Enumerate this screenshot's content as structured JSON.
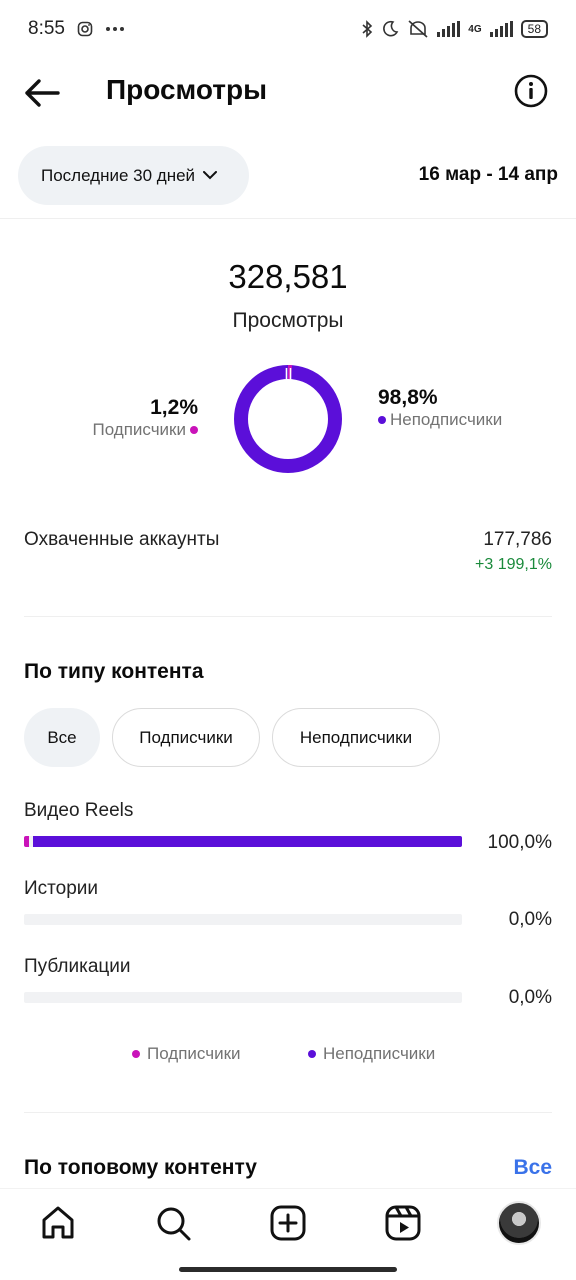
{
  "status_bar": {
    "time": "8:55",
    "network": "4G",
    "battery": "58",
    "icons": [
      "instagram-icon",
      "more-dots-icon",
      "bluetooth-icon",
      "moon-icon",
      "alarm-off-icon",
      "signal-icon",
      "battery-icon"
    ]
  },
  "header": {
    "title": "Просмотры",
    "back_icon": "arrow-left-icon",
    "info_icon": "info-icon"
  },
  "filter": {
    "period_label": "Последние 30 дней",
    "date_range": "16 мар - 14 апр"
  },
  "summary": {
    "total": "328,581",
    "total_label": "Просмотры",
    "followers_pct": "1,2%",
    "followers_label": "Подписчики",
    "non_followers_pct": "98,8%",
    "non_followers_label": "Неподписчики",
    "followers_share": 0.012,
    "non_followers_share": 0.988
  },
  "reach": {
    "label": "Охваченные аккаунты",
    "value": "177,786",
    "delta": "+3 199,1%"
  },
  "content_type": {
    "title": "По типу контента",
    "chips": [
      "Все",
      "Подписчики",
      "Неподписчики"
    ],
    "selected_chip": "Все",
    "rows": [
      {
        "label": "Видео Reels",
        "value": "100,0%",
        "followers_share": 0.012,
        "non_followers_share": 0.988
      },
      {
        "label": "Истории",
        "value": "0,0%",
        "followers_share": 0,
        "non_followers_share": 0
      },
      {
        "label": "Публикации",
        "value": "0,0%",
        "followers_share": 0,
        "non_followers_share": 0
      }
    ],
    "legend": [
      "Подписчики",
      "Неподписчики"
    ]
  },
  "top_content": {
    "title": "По топовому контенту",
    "see_all": "Все"
  },
  "colors": {
    "followers": "#c913b9",
    "non_followers": "#5b0fd9",
    "positive": "#1a8a3b",
    "link": "#3a72e9"
  },
  "nav": [
    "home-icon",
    "search-icon",
    "create-icon",
    "reels-icon",
    "profile-avatar"
  ]
}
